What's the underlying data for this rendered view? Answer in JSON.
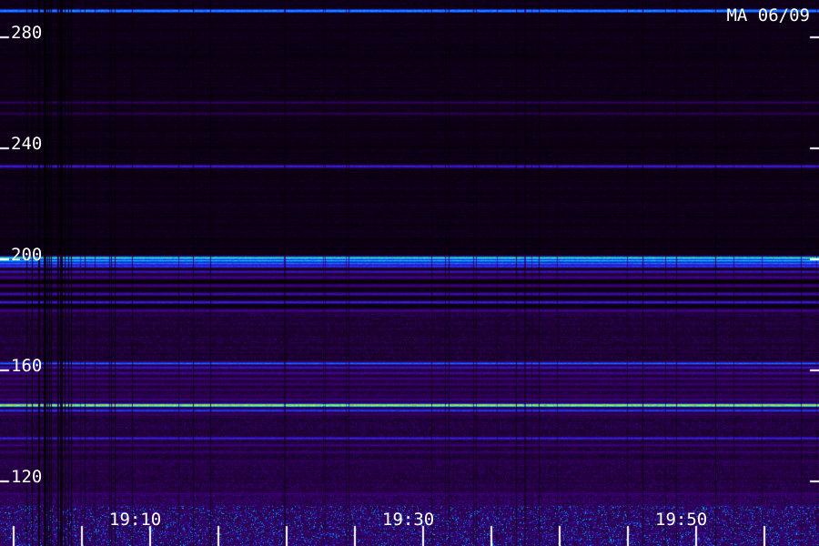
{
  "header": {
    "station_stamp": "MA 06/09"
  },
  "chart_data": {
    "type": "heatmap",
    "title": "",
    "xlabel": "",
    "ylabel": "",
    "xlim_minutes": [
      0,
      60
    ],
    "ylim": [
      112,
      290
    ],
    "y_ticks": [
      {
        "value": 280,
        "label": "280"
      },
      {
        "value": 240,
        "label": "240"
      },
      {
        "value": 200,
        "label": "200"
      },
      {
        "value": 160,
        "label": "160"
      },
      {
        "value": 120,
        "label": "120"
      }
    ],
    "x_ticks": [
      {
        "minute": 10,
        "label": "19:10"
      },
      {
        "minute": 30,
        "label": "19:30"
      },
      {
        "minute": 50,
        "label": "19:50"
      }
    ],
    "bands": [
      {
        "value": 289.5,
        "intensity": 0.58,
        "thickness": 0.8
      },
      {
        "value": 256.5,
        "intensity": 0.22,
        "thickness": 0.5
      },
      {
        "value": 252.5,
        "intensity": 0.2,
        "thickness": 0.5
      },
      {
        "value": 233.5,
        "intensity": 0.42,
        "thickness": 0.6
      },
      {
        "value": 200.5,
        "intensity": 0.68,
        "thickness": 0.7
      },
      {
        "value": 199.5,
        "intensity": 0.58,
        "thickness": 0.7
      },
      {
        "value": 198.5,
        "intensity": 0.5,
        "thickness": 0.8
      },
      {
        "value": 197.5,
        "intensity": 0.44,
        "thickness": 0.8
      },
      {
        "value": 195.5,
        "intensity": 0.36,
        "thickness": 0.8
      },
      {
        "value": 193.5,
        "intensity": 0.3,
        "thickness": 0.9
      },
      {
        "value": 190.5,
        "intensity": 0.28,
        "thickness": 0.9
      },
      {
        "value": 187.5,
        "intensity": 0.36,
        "thickness": 0.7
      },
      {
        "value": 184.5,
        "intensity": 0.42,
        "thickness": 0.6
      },
      {
        "value": 181.5,
        "intensity": 0.3,
        "thickness": 0.8
      },
      {
        "value": 162.5,
        "intensity": 0.5,
        "thickness": 0.6
      },
      {
        "value": 161,
        "intensity": 0.38,
        "thickness": 0.7
      },
      {
        "value": 159,
        "intensity": 0.32,
        "thickness": 0.8
      },
      {
        "value": 157,
        "intensity": 0.28,
        "thickness": 0.8
      },
      {
        "value": 155,
        "intensity": 0.26,
        "thickness": 0.8
      },
      {
        "value": 153,
        "intensity": 0.24,
        "thickness": 0.8
      },
      {
        "value": 151,
        "intensity": 0.22,
        "thickness": 0.8
      },
      {
        "value": 149.5,
        "intensity": 0.3,
        "thickness": 0.5
      },
      {
        "value": 148.5,
        "intensity": 0.2,
        "thickness": 0.6
      },
      {
        "value": 146.5,
        "intensity": 0.2,
        "thickness": 0.6
      },
      {
        "value": 144,
        "intensity": 0.24,
        "thickness": 0.6
      },
      {
        "value": 147.4,
        "intensity": 0.86,
        "thickness": 0.6
      },
      {
        "value": 145.5,
        "intensity": 0.46,
        "thickness": 0.5
      },
      {
        "value": 135.5,
        "intensity": 0.42,
        "thickness": 0.5
      },
      {
        "value": 133,
        "intensity": 0.28,
        "thickness": 0.7
      },
      {
        "value": 130.5,
        "intensity": 0.26,
        "thickness": 0.6
      },
      {
        "value": 127.5,
        "intensity": 0.22,
        "thickness": 0.6
      },
      {
        "value": 115.5,
        "intensity": 0.26,
        "thickness": 0.6
      }
    ],
    "grid": false,
    "legend": "none"
  }
}
